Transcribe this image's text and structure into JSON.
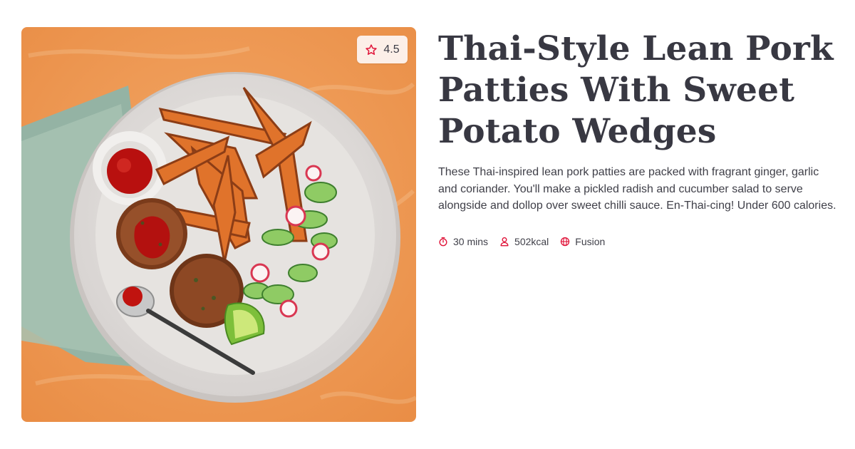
{
  "recipe": {
    "title": "Thai-Style Lean Pork Patties With Sweet Potato Wedges",
    "description": "These Thai-inspired lean pork patties are packed with fragrant ginger, garlic and coriander. You'll make a pickled radish and cucumber salad to serve alongside and dollop over sweet chilli sauce. En-Thai-cing! Under 600 calories.",
    "rating": "4.5",
    "meta": {
      "time": "30 mins",
      "calories": "502kcal",
      "cuisine": "Fusion"
    }
  },
  "icons": {
    "rating": "star-outline-icon",
    "time": "stopwatch-icon",
    "calories": "person-icon",
    "cuisine": "globe-icon"
  },
  "colors": {
    "accent": "#e0153a",
    "background_orange": "#ee9a52",
    "text": "#3a3a44"
  }
}
